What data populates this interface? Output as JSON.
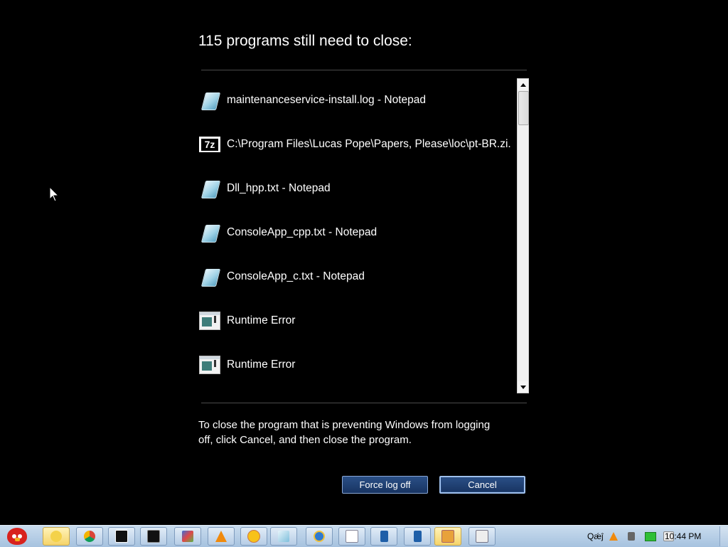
{
  "dialog": {
    "heading": "115 programs still need to close:",
    "programs": [
      {
        "icon": "notepad-icon",
        "label": "maintenanceservice-install.log - Notepad"
      },
      {
        "icon": "7zip-icon",
        "icon_text": "7z",
        "label": "C:\\Program Files\\Lucas Pope\\Papers, Please\\loc\\pt-BR.zi..."
      },
      {
        "icon": "notepad-icon",
        "label": "Dll_hpp.txt - Notepad"
      },
      {
        "icon": "notepad-icon",
        "label": "ConsoleApp_cpp.txt - Notepad"
      },
      {
        "icon": "notepad-icon",
        "label": "ConsoleApp_c.txt - Notepad"
      },
      {
        "icon": "runtime-error-icon",
        "label": "Runtime Error"
      },
      {
        "icon": "runtime-error-icon",
        "label": "Runtime Error"
      }
    ],
    "info_text": "To close the program that is preventing Windows from logging off, click Cancel, and then close the program.",
    "force_button_label": "Force log off",
    "cancel_button_label": "Cancel"
  },
  "taskbar": {
    "start": "angry-birds-orb-icon",
    "items": [
      {
        "icon": "explorer-yellow-icon",
        "active": true
      },
      {
        "icon": "chrome-icon"
      },
      {
        "icon": "7zip-icon"
      },
      {
        "icon": "cmd-icon"
      },
      {
        "icon": "paint-app-icon"
      },
      {
        "icon": "vlc-icon"
      },
      {
        "icon": "emoji-app-icon"
      },
      {
        "icon": "notepad-icon"
      },
      {
        "icon": "internet-explorer-icon"
      },
      {
        "icon": "document-icon"
      },
      {
        "icon": "blue-book-icon"
      },
      {
        "icon": "blue-book-icon"
      },
      {
        "icon": "folder-window-icon",
        "active": true
      },
      {
        "icon": "window-icon"
      }
    ],
    "tray_text": "Qǽĵ",
    "clock": "10:44 PM"
  },
  "colors": {
    "background": "#000000",
    "button": "#1f3f73",
    "taskbar": "#b6cde6"
  }
}
